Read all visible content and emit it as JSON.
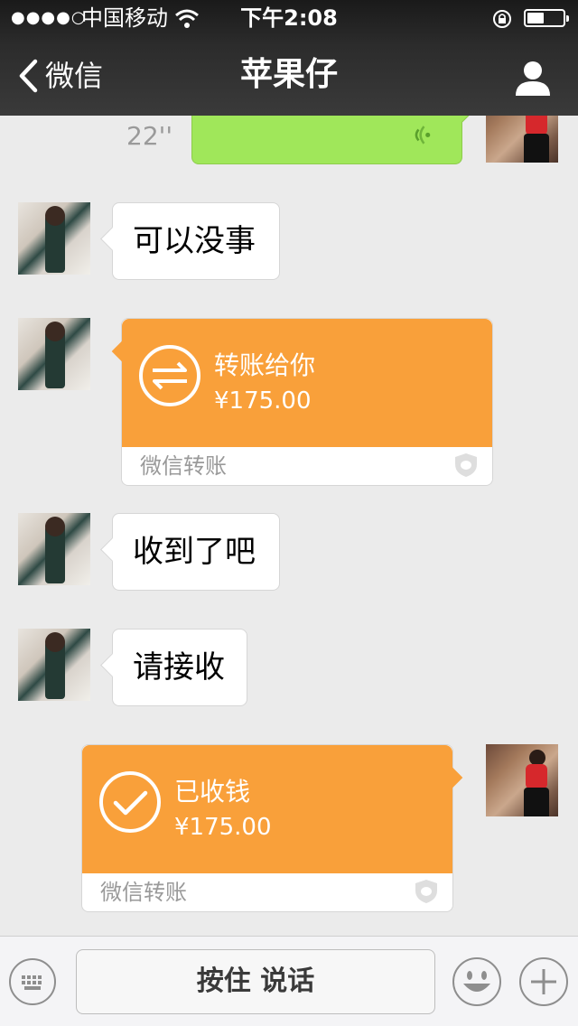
{
  "status_bar": {
    "signal": "●●●●○",
    "carrier": "中国移动",
    "time": "下午2:08"
  },
  "nav": {
    "back_label": "微信",
    "title": "苹果仔"
  },
  "messages": {
    "voice_duration": "22''",
    "msg1": "可以没事",
    "transfer1": {
      "label": "转账给你",
      "amount": "¥175.00",
      "footer": "微信转账"
    },
    "msg2": "收到了吧",
    "msg3": "请接收",
    "transfer2": {
      "label": "已收钱",
      "amount": "¥175.00",
      "footer": "微信转账"
    }
  },
  "input_bar": {
    "hold_to_talk": "按住 说话"
  },
  "colors": {
    "transfer_orange": "#f9a03a",
    "voice_green": "#a0e75a",
    "chat_bg": "#ebebeb"
  }
}
